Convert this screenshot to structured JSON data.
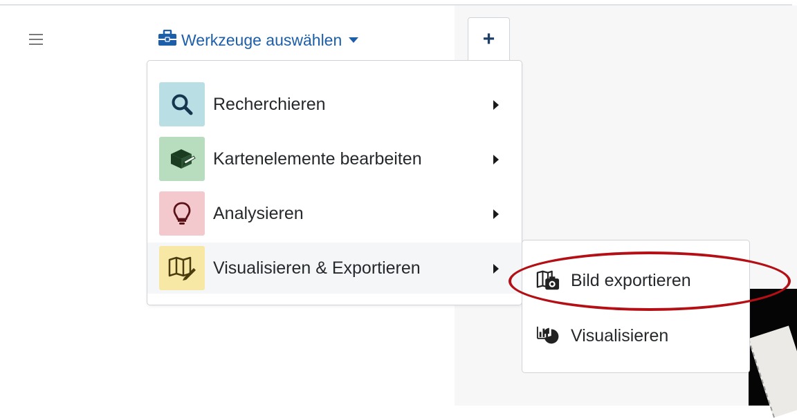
{
  "toolbar": {
    "tools_label": "Werkzeuge auswählen",
    "tools_icon": "briefcase-icon",
    "menu_icon": "hamburger-icon",
    "add_icon": "plus-icon",
    "add_label": "+"
  },
  "menu": {
    "items": [
      {
        "label": "Recherchieren",
        "icon": "search-icon",
        "color": "#b9dfe5"
      },
      {
        "label": "Kartenelemente bearbeiten",
        "icon": "edit-cube-icon",
        "color": "#b7dcbe"
      },
      {
        "label": "Analysieren",
        "icon": "lightbulb-icon",
        "color": "#f3c9cd"
      },
      {
        "label": "Visualisieren & Exportieren",
        "icon": "map-pencil-icon",
        "color": "#f7e8a6"
      }
    ]
  },
  "submenu": {
    "items": [
      {
        "label": "Bild exportieren",
        "icon": "map-camera-icon"
      },
      {
        "label": "Visualisieren",
        "icon": "chart-pie-icon"
      }
    ]
  },
  "colors": {
    "link": "#1d5ea9",
    "highlight": "#b30f15"
  }
}
